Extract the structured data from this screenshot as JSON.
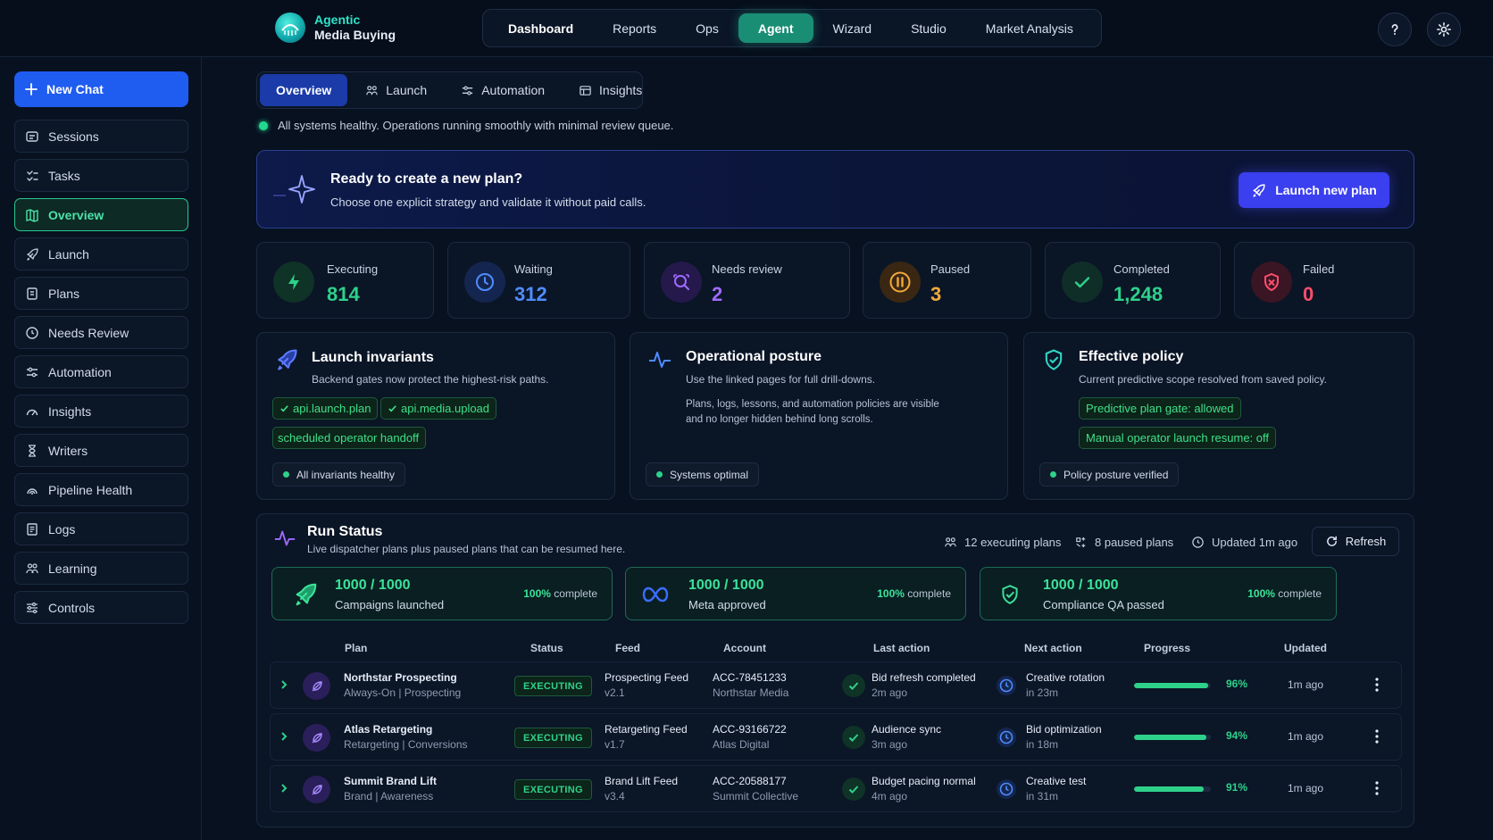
{
  "app": {
    "name_line1": "Agentic",
    "name_line2": "Media Buying"
  },
  "topnav": [
    "Dashboard",
    "Reports",
    "Ops",
    "Agent",
    "Wizard",
    "Studio",
    "Market Analysis"
  ],
  "topnav_active": "Agent",
  "sidebar": {
    "new_chat": "New Chat",
    "items": [
      "Sessions",
      "Tasks",
      "Overview",
      "Launch",
      "Plans",
      "Needs Review",
      "Automation",
      "Insights",
      "Writers",
      "Pipeline Health",
      "Logs",
      "Learning",
      "Controls"
    ],
    "active": "Overview"
  },
  "tabs": [
    "Overview",
    "Launch",
    "Automation",
    "Insights"
  ],
  "health": "All systems healthy. Operations running smoothly with minimal review queue.",
  "banner": {
    "title": "Ready to create a new plan?",
    "subtitle": "Choose one explicit strategy and validate it without paid calls.",
    "button": "Launch new plan"
  },
  "stats": [
    {
      "label": "Executing",
      "value": "814",
      "color": "#2ed18a"
    },
    {
      "label": "Waiting",
      "value": "312",
      "color": "#4f8cff"
    },
    {
      "label": "Needs review",
      "value": "2",
      "color": "#a06bff"
    },
    {
      "label": "Paused",
      "value": "3",
      "color": "#f2a93b"
    },
    {
      "label": "Completed",
      "value": "1,248",
      "color": "#2ed18a"
    },
    {
      "label": "Failed",
      "value": "0",
      "color": "#ff4d6d"
    }
  ],
  "cards": {
    "invariants": {
      "title": "Launch invariants",
      "subtitle": "Backend gates now protect the highest-risk paths.",
      "chips": [
        "api.launch.plan",
        "api.media.upload",
        "scheduled operator handoff"
      ],
      "status": "All invariants healthy"
    },
    "posture": {
      "title": "Operational posture",
      "subtitle": "Use the linked pages for full drill-downs.",
      "body_line1": "Plans, logs, lessons, and automation policies are visible",
      "body_line2": "and no longer hidden behind long scrolls.",
      "status": "Systems optimal"
    },
    "policy": {
      "title": "Effective policy",
      "subtitle": "Current predictive scope resolved from saved policy.",
      "chips": [
        "Predictive plan gate: allowed",
        "Manual operator launch resume: off"
      ],
      "status": "Policy posture verified"
    }
  },
  "run_status": {
    "title": "Run Status",
    "subtitle": "Live dispatcher plans plus paused plans that can be resumed here.",
    "executing": "12 executing plans",
    "paused": "8 paused plans",
    "updated": "Updated 1m ago",
    "refresh": "Refresh",
    "kpis": [
      {
        "value": "1000 / 1000",
        "label": "Campaigns launched",
        "pct": "100%",
        "pct_suffix": "complete"
      },
      {
        "value": "1000 / 1000",
        "label": "Meta approved",
        "pct": "100%",
        "pct_suffix": "complete"
      },
      {
        "value": "1000 / 1000",
        "label": "Compliance QA passed",
        "pct": "100%",
        "pct_suffix": "complete"
      }
    ],
    "columns": [
      "Plan",
      "Status",
      "Feed",
      "Account",
      "Last action",
      "Next action",
      "Progress",
      "Updated"
    ],
    "rows": [
      {
        "name": "Northstar Prospecting",
        "sub": "Always-On | Prospecting",
        "status": "EXECUTING",
        "feed": "Prospecting Feed",
        "feed_ver": "v2.1",
        "account": "ACC-78451233",
        "account_name": "Northstar Media",
        "last": "Bid refresh completed",
        "last_time": "2m ago",
        "next": "Creative rotation",
        "next_time": "in 23m",
        "progress": 96,
        "progress_label": "96%",
        "updated": "1m ago"
      },
      {
        "name": "Atlas Retargeting",
        "sub": "Retargeting | Conversions",
        "status": "EXECUTING",
        "feed": "Retargeting Feed",
        "feed_ver": "v1.7",
        "account": "ACC-93166722",
        "account_name": "Atlas Digital",
        "last": "Audience sync",
        "last_time": "3m ago",
        "next": "Bid optimization",
        "next_time": "in 18m",
        "progress": 94,
        "progress_label": "94%",
        "updated": "1m ago"
      },
      {
        "name": "Summit Brand Lift",
        "sub": "Brand | Awareness",
        "status": "EXECUTING",
        "feed": "Brand Lift Feed",
        "feed_ver": "v3.4",
        "account": "ACC-20588177",
        "account_name": "Summit Collective",
        "last": "Budget pacing normal",
        "last_time": "4m ago",
        "next": "Creative test",
        "next_time": "in 31m",
        "progress": 91,
        "progress_label": "91%",
        "updated": "1m ago"
      }
    ]
  }
}
